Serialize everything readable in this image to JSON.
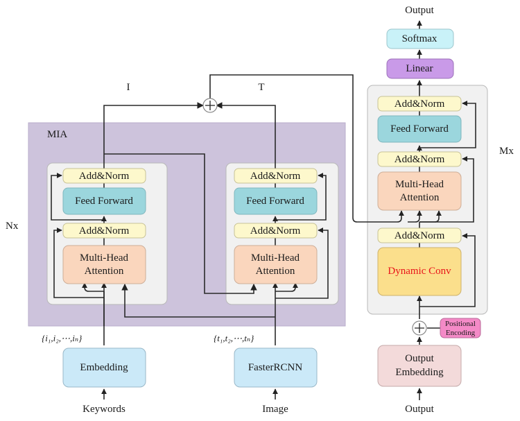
{
  "labels": {
    "mia": "MIA",
    "nx": "Nx",
    "mx": "Mx",
    "i_branch": "I",
    "t_branch": "T",
    "top_output": "Output",
    "keyword_seq": "{i₁,i₂,⋯,iₙ}",
    "image_seq": "{t₁,t₂,⋯,tₙ}",
    "keywords_input": "Keywords",
    "image_input": "Image",
    "output_input": "Output"
  },
  "left_encoder": {
    "add_norm_top": "Add&Norm",
    "feed_forward": "Feed Forward",
    "add_norm_bottom": "Add&Norm",
    "mha_line1": "Multi-Head",
    "mha_line2": "Attention"
  },
  "right_encoder": {
    "add_norm_top": "Add&Norm",
    "feed_forward": "Feed Forward",
    "add_norm_bottom": "Add&Norm",
    "mha_line1": "Multi-Head",
    "mha_line2": "Attention"
  },
  "embedding": "Embedding",
  "fasterrcnn": "FasterRCNN",
  "decoder": {
    "softmax": "Softmax",
    "linear": "Linear",
    "add_norm_1": "Add&Norm",
    "feed_forward": "Feed Forward",
    "add_norm_2": "Add&Norm",
    "mha_line1": "Multi-Head",
    "mha_line2": "Attention",
    "add_norm_3": "Add&Norm",
    "dynamic_conv": "Dynamic Conv",
    "positional_line1": "Positional",
    "positional_line2": "Encoding",
    "output_emb_line1": "Output",
    "output_emb_line2": "Embedding"
  },
  "colors": {
    "mia_bg": "#cdc3dc",
    "block_bg": "#f1f1f1",
    "add_norm": "#fdf8cc",
    "feed_forward": "#9bd6dd",
    "mha": "#fad6bd",
    "embedding": "#cbe9f8",
    "softmax": "#c9f2f8",
    "linear": "#c99ae8",
    "dynamic_conv": "#fbdf8c",
    "dynamic_conv_text": "#e8141a",
    "positional": "#f48ac7",
    "output_embedding": "#f3dada"
  }
}
